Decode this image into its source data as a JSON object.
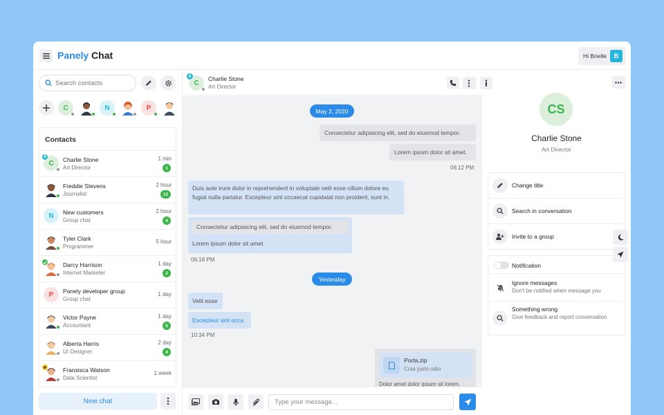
{
  "app": {
    "logo_part1": "Panely",
    "logo_part2": "Chat",
    "greeting": "Hi Brielle",
    "user_initial": "B"
  },
  "sidebar": {
    "search_placeholder": "Search contacts",
    "favorites": [
      {
        "initial": "C",
        "color": "#3bb54a",
        "status": "away"
      },
      {
        "initial": "",
        "type": "photo",
        "status": "online"
      },
      {
        "initial": "N",
        "color": "#26b6dc",
        "status": "online"
      },
      {
        "initial": "",
        "type": "photo",
        "status": "away"
      },
      {
        "initial": "P",
        "color": "#e84a4a",
        "status": "online"
      },
      {
        "initial": "",
        "type": "photo",
        "status": "none"
      }
    ],
    "contacts_title": "Contacts",
    "contacts": [
      {
        "name": "Charlie Stone",
        "sub": "Art Director",
        "time": "1 min",
        "badge": "1",
        "initial": "C",
        "avatar_color": "#3bb54a",
        "avatar_bg": "#dcefdc",
        "status": "away",
        "corner_badge": "8"
      },
      {
        "name": "Freddie Stevens",
        "sub": "Journalist",
        "time": "2 hour",
        "badge": "12",
        "initial": "",
        "avatar_color": "#555",
        "avatar_bg": "#2e3a4a",
        "status": "online"
      },
      {
        "name": "New customers",
        "sub": "Group chat",
        "time": "2 hour",
        "badge": "4",
        "initial": "N",
        "avatar_color": "#26b6dc",
        "avatar_bg": "#d8f2f9",
        "status": "none"
      },
      {
        "name": "Tyler Clark",
        "sub": "Programmer",
        "time": "5 hour",
        "badge": "",
        "initial": "",
        "avatar_color": "#555",
        "avatar_bg": "#7a4b3a",
        "status": "online"
      },
      {
        "name": "Darcy Harrison",
        "sub": "Internet Marketer",
        "time": "1 day",
        "badge": "2",
        "initial": "",
        "avatar_color": "#555",
        "avatar_bg": "#d86d3c",
        "status": "away",
        "check": true
      },
      {
        "name": "Panely developer group",
        "sub": "Group chat",
        "time": "1 day",
        "badge": "",
        "initial": "P",
        "avatar_color": "#e84a4a",
        "avatar_bg": "#fbe2e2",
        "status": "none"
      },
      {
        "name": "Victor Payne",
        "sub": "Accountant",
        "time": "1 day",
        "badge": "5",
        "initial": "",
        "avatar_color": "#555",
        "avatar_bg": "#3b4c60",
        "status": "online"
      },
      {
        "name": "Alberta Harris",
        "sub": "UI Designer",
        "time": "2 day",
        "badge": "4",
        "initial": "",
        "avatar_color": "#555",
        "avatar_bg": "#e8b36a",
        "status": "away"
      },
      {
        "name": "Fransisca Watson",
        "sub": "Data Scientist",
        "time": "1 week",
        "badge": "",
        "initial": "",
        "avatar_color": "#555",
        "avatar_bg": "#b33b3b",
        "status": "away",
        "star": true
      }
    ],
    "new_chat_label": "New chat"
  },
  "chat": {
    "header_name": "Charlie Stone",
    "header_role": "Art Director",
    "header_initial": "C",
    "header_badge": "8",
    "date1": "May 2, 2020",
    "out_msg1": "Consectetur adipisicing elit, sed do eiusmod tempor.",
    "out_msg2": "Lorem ipsum dolor sit amet.",
    "out_time1": "06:12 PM",
    "in_msg1": "Duis aute irure dolor in reprehenderit in voluptate velit esse cillum dolore eu fugiat nulla pariatur. Excepteur sint occaecat cupidatat non proident, sunt in.",
    "in_quote": "Consectetur adipisicing elit, sed do eiusmod tempor.",
    "in_reply": "Lorem ipsum dolor sit amet",
    "in_time1": "06:18 PM",
    "date2": "Yestesday",
    "in_msg2": "Velit esse",
    "in_msg3": "Excepteur sint occa",
    "in_time2": "10:34 PM",
    "file_name": "Porta.zip",
    "file_sub": "Cras justo odio",
    "file_caption": "Dolor amet dolor ipsum sit lorem.",
    "input_placeholder": "Type your message..."
  },
  "profile": {
    "initials": "CS",
    "name": "Charlie Stone",
    "role": "Art Director",
    "actions": [
      {
        "label": "Change title",
        "icon": "pencil-icon"
      },
      {
        "label": "Search in conversation",
        "icon": "search-icon"
      },
      {
        "label": "Invite to a group",
        "icon": "user-plus-icon"
      }
    ],
    "notification_label": "Notification",
    "ignore_title": "Ignore messages",
    "ignore_sub": "Don't be notified when message you",
    "wrong_title": "Something wrong",
    "wrong_sub": "Give feedback and report conversation"
  }
}
